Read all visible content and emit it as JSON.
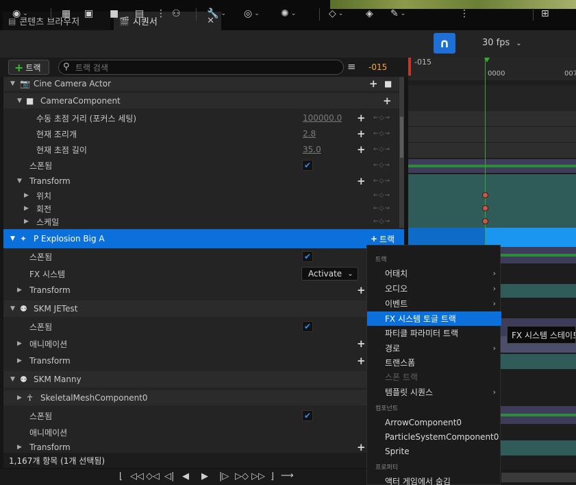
{
  "tabs": [
    {
      "label": "콘텐츠 브라우저"
    },
    {
      "label": "시퀀서"
    }
  ],
  "toolbar": {
    "fps": "30 fps"
  },
  "search": {
    "add_track": "트랙",
    "placeholder": "트랙 검색",
    "current_frame": "-015"
  },
  "timeline": {
    "ruler_labels": [
      "-015",
      "0000",
      "007"
    ]
  },
  "tree": {
    "cine_camera": "Cine Camera Actor",
    "camera_component": "CameraComponent",
    "manual_focus": "수동 초점 거리 (포커스 세팅)",
    "manual_focus_val": "100000.0",
    "aperture": "현재 조리개",
    "aperture_val": "2.8",
    "focal": "현재 초점 길이",
    "focal_val": "35.0",
    "spawned": "스폰됨",
    "transform": "Transform",
    "location": "위치",
    "rotation": "회전",
    "scale": "스케일",
    "explosion": "P Explosion Big A",
    "explosion_track": "트랙",
    "fx_system": "FX 시스템",
    "activate": "Activate",
    "skm_jetest": "SKM JETest",
    "animation": "애니메이션",
    "skm_manny": "SKM Manny",
    "skeletal": "SkeletalMeshComponent0"
  },
  "status": "1,167개 항목 (1개 선택됨)",
  "menu": {
    "h_track": "트랙",
    "attach": "어태치",
    "audio": "오디오",
    "event": "이벤트",
    "fx_toggle": "FX 시스템 토글 트랙",
    "particle_param": "파티클 파라미터 트랙",
    "path": "경로",
    "transform": "트랜스폼",
    "spawn": "스폰 트랙",
    "template": "템플릿 시퀀스",
    "h_component": "컴포넌트",
    "arrow": "ArrowComponent0",
    "particle_sys": "ParticleSystemComponent0",
    "sprite": "Sprite",
    "h_property": "프로퍼티",
    "hide_in_game": "액터 게임에서 숨김"
  },
  "tooltip": "FX 시스템 스테이트 트랙",
  "colors": {
    "accent": "#0b70dc",
    "playhead": "#3aa63a",
    "frame": "#ffa53a"
  }
}
